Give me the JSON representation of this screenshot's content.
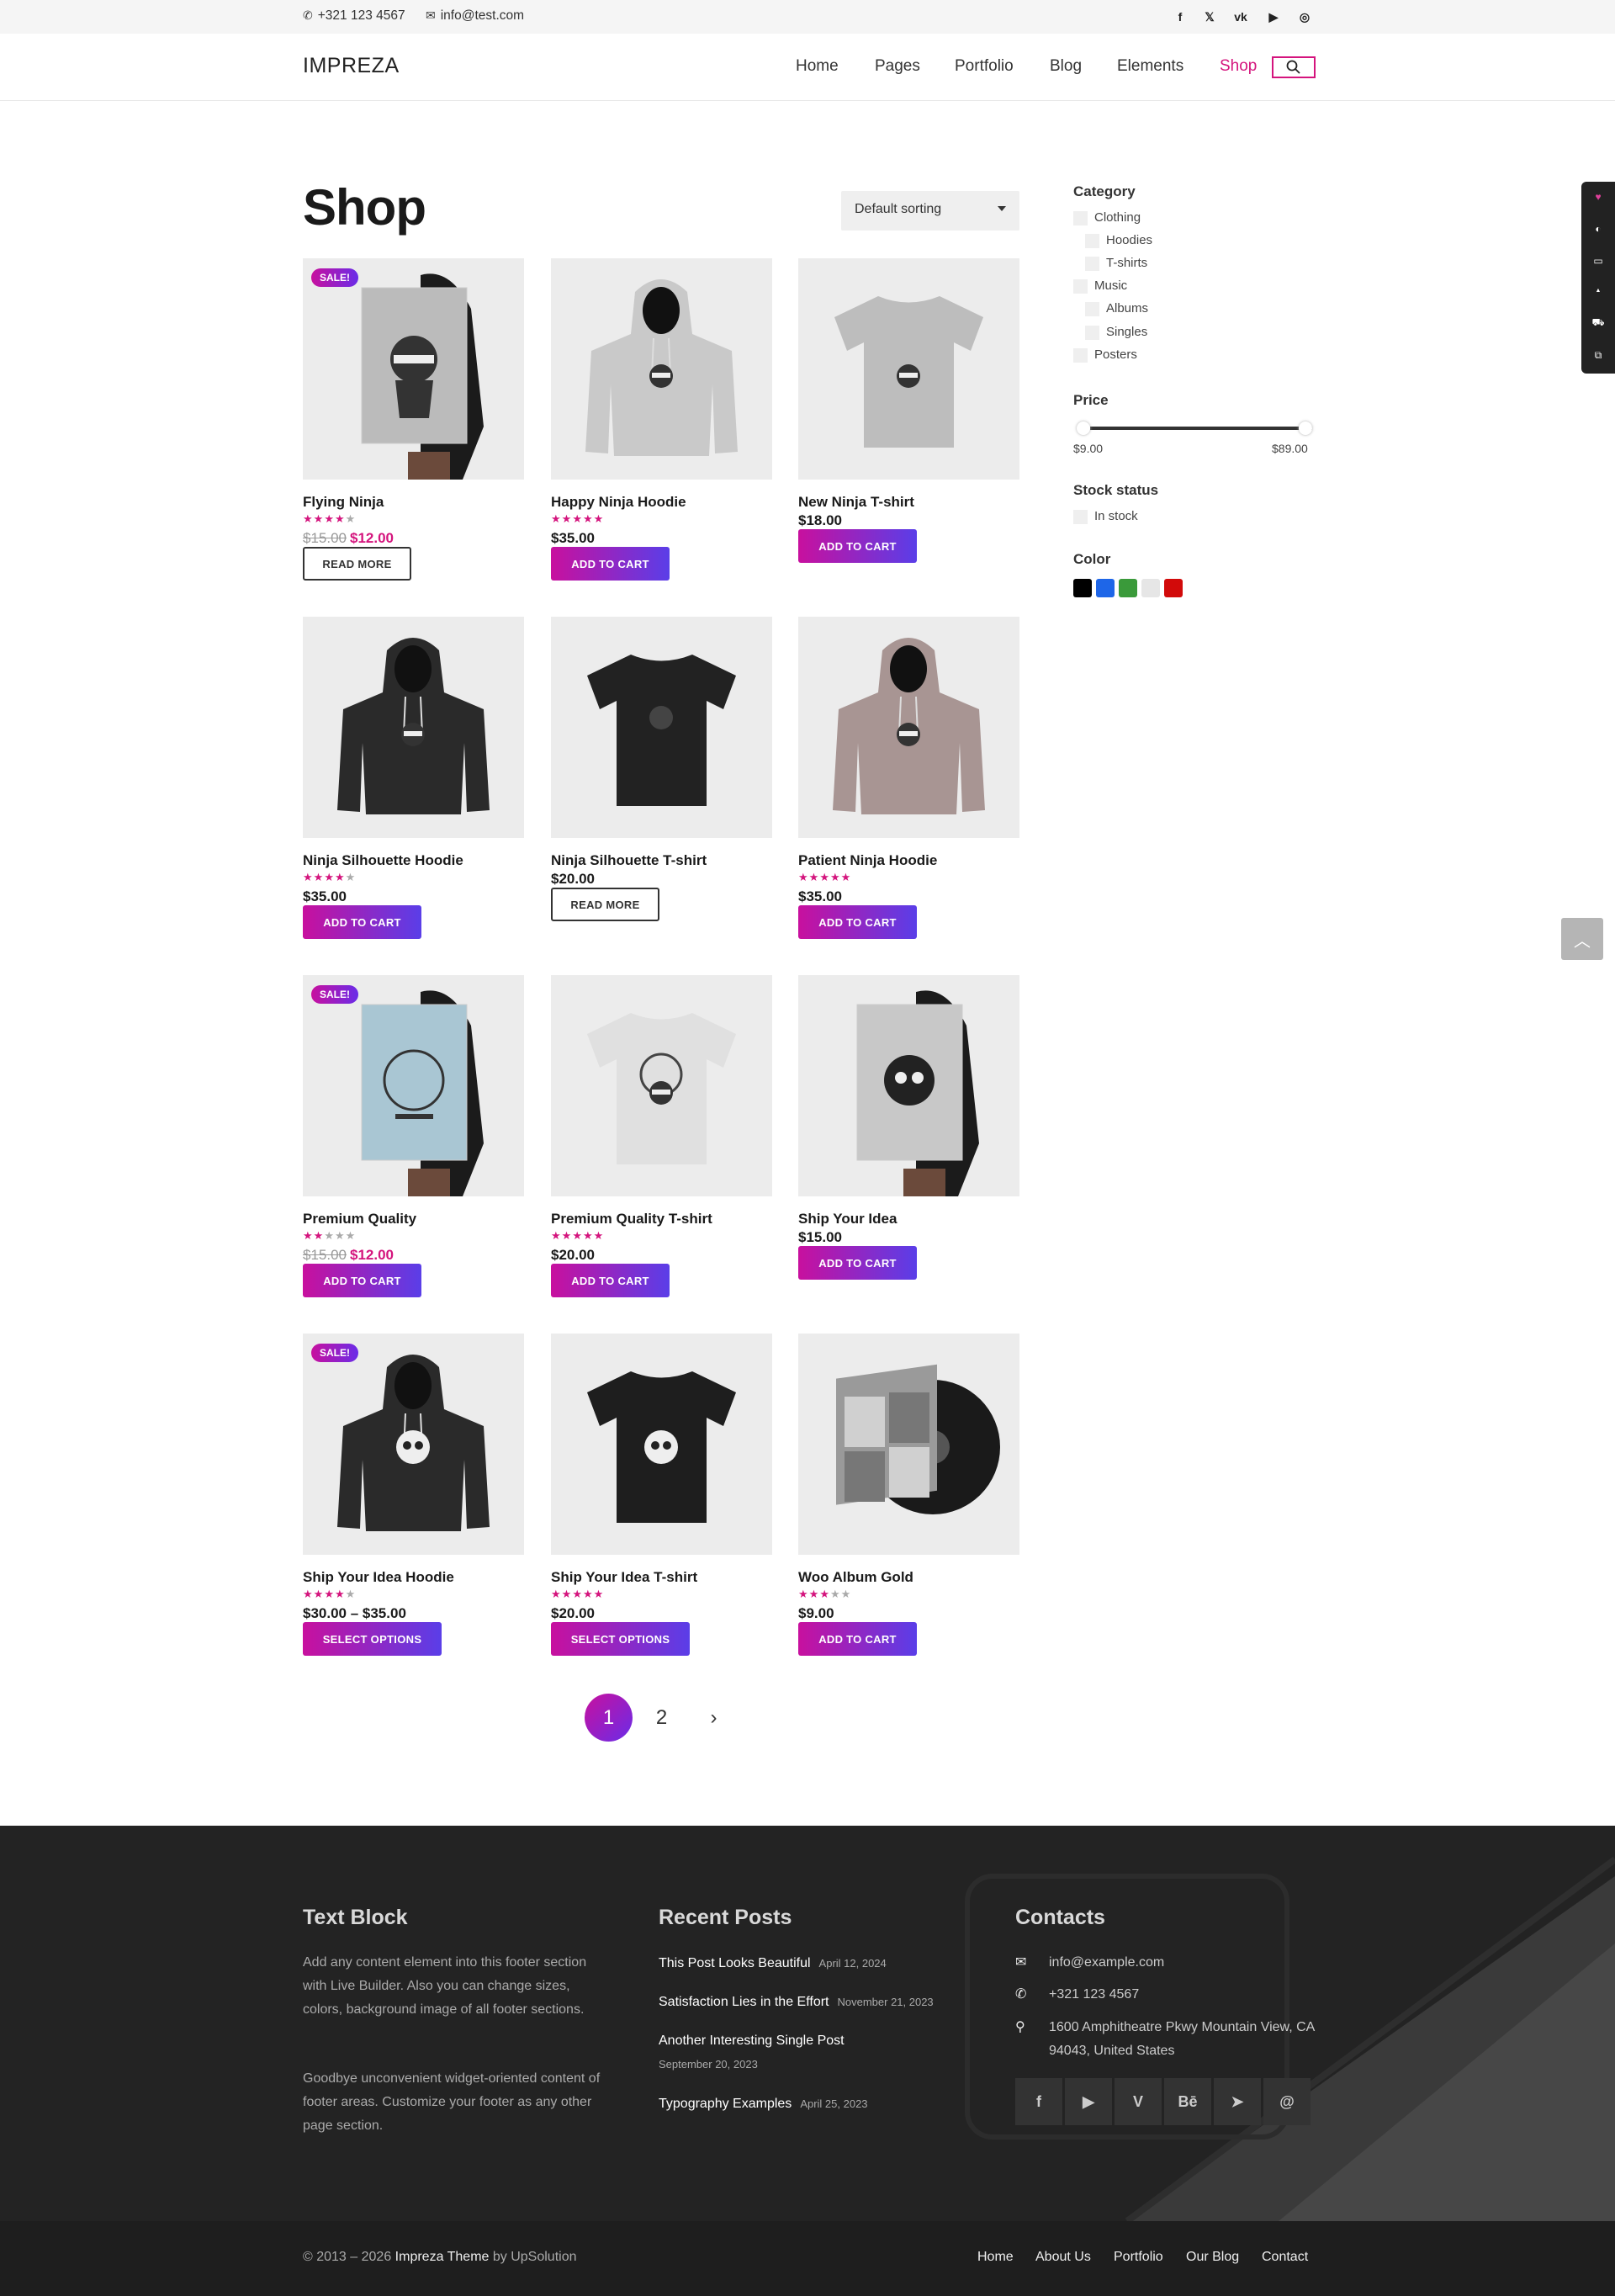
{
  "topbar": {
    "phone": "+321 123 4567",
    "email": "info@test.com",
    "social": [
      "facebook-icon",
      "x-icon",
      "vk-icon",
      "youtube-icon",
      "instagram-icon"
    ]
  },
  "header": {
    "logo": "IMPREZA",
    "nav": [
      {
        "label": "Home"
      },
      {
        "label": "Pages"
      },
      {
        "label": "Portfolio"
      },
      {
        "label": "Blog"
      },
      {
        "label": "Elements"
      },
      {
        "label": "Shop",
        "active": true
      }
    ]
  },
  "page": {
    "title": "Shop",
    "sorting": "Default sorting"
  },
  "products": [
    {
      "name": "Flying Ninja",
      "rating": 4,
      "old_price": "$15.00",
      "price": "$12.00",
      "sale": true,
      "button": "Read more",
      "sale_label": "SALE!"
    },
    {
      "name": "Happy Ninja Hoodie",
      "rating": 5,
      "price": "$35.00",
      "button": "Add to cart"
    },
    {
      "name": "New Ninja T-shirt",
      "rating": 0,
      "price": "$18.00",
      "button": "Add to cart"
    },
    {
      "name": "Ninja Silhouette Hoodie",
      "rating": 4,
      "price": "$35.00",
      "button": "Add to cart"
    },
    {
      "name": "Ninja Silhouette T-shirt",
      "rating": 0,
      "price": "$20.00",
      "button": "Read more"
    },
    {
      "name": "Patient Ninja Hoodie",
      "rating": 5,
      "price": "$35.00",
      "button": "Add to cart"
    },
    {
      "name": "Premium Quality",
      "rating": 2,
      "old_price": "$15.00",
      "price": "$12.00",
      "sale": true,
      "button": "Add to cart",
      "sale_label": "SALE!"
    },
    {
      "name": "Premium Quality T-shirt",
      "rating": 5,
      "price": "$20.00",
      "button": "Add to cart"
    },
    {
      "name": "Ship Your Idea",
      "rating": 0,
      "price": "$15.00",
      "button": "Add to cart"
    },
    {
      "name": "Ship Your Idea Hoodie",
      "rating": 4,
      "price": "$30.00 – $35.00",
      "sale": true,
      "button": "Select options",
      "sale_label": "SALE!"
    },
    {
      "name": "Ship Your Idea T-shirt",
      "rating": 5,
      "price": "$20.00",
      "button": "Select options"
    },
    {
      "name": "Woo Album Gold",
      "rating": 3,
      "price": "$9.00",
      "button": "Add to cart"
    }
  ],
  "sidebar": {
    "category_title": "Category",
    "categories": [
      {
        "label": "Clothing",
        "level": 0
      },
      {
        "label": "Hoodies",
        "level": 1
      },
      {
        "label": "T-shirts",
        "level": 1
      },
      {
        "label": "Music",
        "level": 0
      },
      {
        "label": "Albums",
        "level": 1
      },
      {
        "label": "Singles",
        "level": 1
      },
      {
        "label": "Posters",
        "level": 0
      }
    ],
    "price_title": "Price",
    "price_min": "$9.00",
    "price_max": "$89.00",
    "stock_title": "Stock status",
    "stock_option": "In stock",
    "color_title": "Color",
    "colors": [
      "#000000",
      "#1e66e8",
      "#3a9a3a",
      "#e6e6e6",
      "#d20a0a"
    ]
  },
  "pagination": [
    "1",
    "2"
  ],
  "footer": {
    "text_title": "Text Block",
    "text_p1": "Add any content element into this footer section with Live Builder. Also you can change sizes, colors, background image of all footer sections.",
    "text_p2": "Goodbye unconvenient widget-oriented content of footer areas. Customize your footer as any other page section.",
    "posts_title": "Recent Posts",
    "posts": [
      {
        "title": "This Post Looks Beautiful",
        "date": "April 12, 2024"
      },
      {
        "title": "Satisfaction Lies in the Effort",
        "date": "November 21, 2023"
      },
      {
        "title": "Another Interesting Single Post",
        "date": "September 20, 2023"
      },
      {
        "title": "Typography Examples",
        "date": "April 25, 2023"
      }
    ],
    "contacts_title": "Contacts",
    "contact_email": "info@example.com",
    "contact_phone": "+321 123 4567",
    "contact_address": "1600 Amphitheatre Pkwy Mountain View, CA 94043, United States",
    "socials": [
      "f",
      "▶",
      "V",
      "Bē",
      "➤",
      "@"
    ]
  },
  "bottombar": {
    "copy_prefix": "© 2013 – 2026",
    "copy_theme": "Impreza Theme",
    "copy_by": "by UpSolution",
    "links": [
      "Home",
      "About Us",
      "Portfolio",
      "Our Blog",
      "Contact"
    ]
  }
}
